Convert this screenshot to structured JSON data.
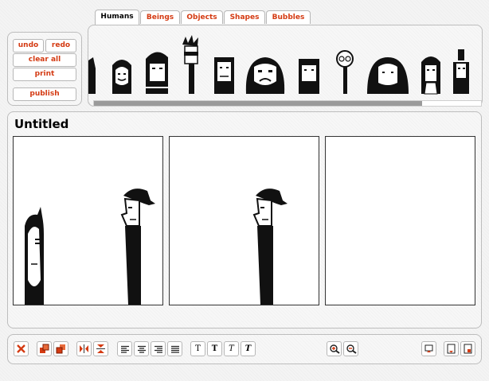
{
  "commands": {
    "undo": "undo",
    "redo": "redo",
    "clear_all": "clear all",
    "print": "print",
    "publish": "publish"
  },
  "tabs": [
    {
      "label": "Humans",
      "active": true
    },
    {
      "label": "Beings",
      "active": false
    },
    {
      "label": "Objects",
      "active": false
    },
    {
      "label": "Shapes",
      "active": false
    },
    {
      "label": "Bubbles",
      "active": false
    }
  ],
  "comic": {
    "title": "Untitled",
    "panels": [
      {
        "characters": [
          "ghost-woman",
          "shaggy-man"
        ]
      },
      {
        "characters": [
          "shaggy-man"
        ]
      },
      {
        "characters": []
      }
    ]
  },
  "library": {
    "characters": [
      "partial",
      "smiling-woman",
      "bearded-man",
      "spiky-hair-sunglasses",
      "square-face-man",
      "big-man",
      "short-hair-man",
      "round-glasses-man",
      "heavy-woman",
      "long-hair-woman",
      "tall-hat-man"
    ]
  },
  "toolbar": {
    "icons": [
      "delete-icon",
      "bring-forward-icon",
      "send-backward-icon",
      "flip-horizontal-icon",
      "flip-vertical-icon",
      "align-left-icon",
      "align-center-icon",
      "align-right-icon",
      "align-justify-icon",
      "text-normal-icon",
      "text-bold-icon",
      "text-italic-icon",
      "text-bold-italic-icon",
      "zoom-in-icon",
      "zoom-out-icon",
      "add-panel-icon",
      "save-icon",
      "export-icon"
    ],
    "text_glyph": "T"
  },
  "colors": {
    "accent": "#d43a12",
    "background": "#f4f4f4"
  }
}
